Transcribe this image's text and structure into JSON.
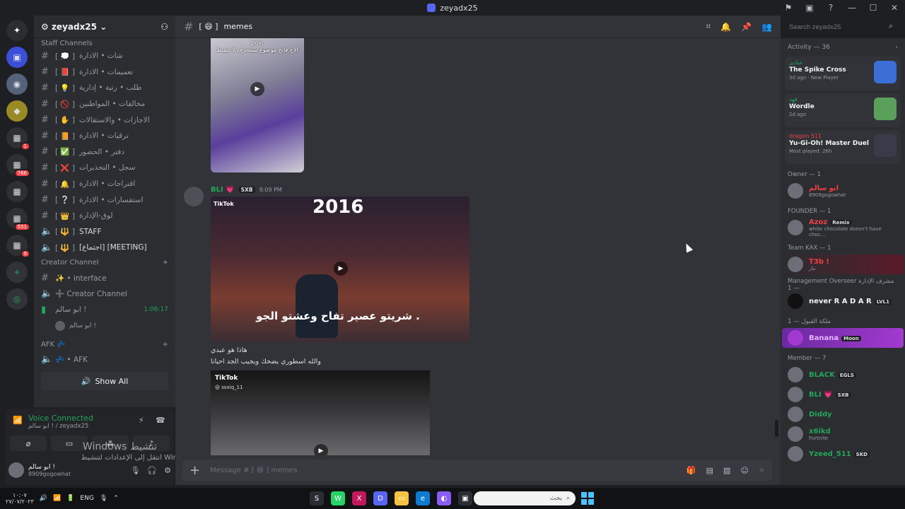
{
  "window": {
    "title": "zeyadx25",
    "controls": [
      "⚑",
      "▣",
      "?",
      "—",
      "☐",
      "✕"
    ]
  },
  "guilds": {
    "home_icon": "discord-icon",
    "badges": [
      "1",
      "766",
      "551",
      "9"
    ]
  },
  "server": {
    "name": "zeyadx25",
    "category_staff": "Staff Channels",
    "channels": [
      {
        "type": "text",
        "emoji_color": "#ffffff",
        "label": "شات • الادارة",
        "bracket": "[ 💭 ]"
      },
      {
        "type": "text",
        "emoji_color": "#e33c5a",
        "label": "تعميمات • الادارة",
        "bracket": "[ 📕 ]"
      },
      {
        "type": "text",
        "emoji_color": "#f5c242",
        "label": "طلب • رتبة • إدارية",
        "bracket": "[ 💡 ]"
      },
      {
        "type": "text",
        "emoji_color": "#e33c3c",
        "label": "مخالفات • المواطنين",
        "bracket": "[ 🚫 ]"
      },
      {
        "type": "text",
        "emoji_color": "#f0c8a0",
        "label": "الاجازات • والاستقالات",
        "bracket": "[ ✋ ]"
      },
      {
        "type": "text",
        "emoji_color": "#e8a33c",
        "label": "ترقيات • الادارة",
        "bracket": "[ 📙 ]"
      },
      {
        "type": "text",
        "emoji_color": "#3ca55c",
        "label": "دفتر • الحضور",
        "bracket": "[ ✅ ]"
      },
      {
        "type": "text",
        "emoji_color": "#e33c5a",
        "label": "سجل • التحذيرات",
        "bracket": "[ ❌ ]"
      },
      {
        "type": "text",
        "emoji_color": "#f5c242",
        "label": "اقتراحات • الادارة",
        "bracket": "[ 🔔 ]"
      },
      {
        "type": "text",
        "emoji_color": "#ffffff",
        "label": "استفسارات • الادارة",
        "bracket": "[ ❔ ]"
      },
      {
        "type": "text",
        "emoji_color": "#f5c242",
        "label": "لوق-الإدارة",
        "bracket": "[ 👑 ]"
      },
      {
        "type": "voice",
        "emoji_color": "#e8a33c",
        "label": "STAFF",
        "bracket": "[ 🔱 ]"
      },
      {
        "type": "voice",
        "emoji_color": "#e8a33c",
        "label": "[اجتماع] [MEETING]",
        "bracket": "[ 🔱 ]"
      }
    ],
    "category_creator": "Creator Channel",
    "creator_channels": [
      {
        "type": "text",
        "label": "✨ • interface"
      },
      {
        "type": "voice",
        "label": "➕ Creator Channel"
      }
    ],
    "voice_live": {
      "name": "ابو سالم !",
      "time": "1:06:17"
    },
    "voice_member": "ابو سالم !",
    "category_afk": "AFK 💤",
    "afk_channel": "💤 • AFK",
    "show_all": "Show All"
  },
  "voice_panel": {
    "title": "Voice Connected",
    "subtitle": "ابو سالم ! / zeyadx25",
    "user_name": "ابو سالم !",
    "user_status": "8909gogowhat"
  },
  "watermark": {
    "line1": "Windows تنشيط",
    "line2": "انتقل إلى الإعدادات لتنشيط Windows."
  },
  "channel": {
    "name": "memes",
    "bracket": "[ 😄 ]",
    "search_placeholder": "Search zeyadx25"
  },
  "messages": {
    "video1_caption_top": "pov:",
    "video1_caption": "الاخ فاتح موضوع سنتحرف لا تتمنط",
    "author": "BLI 💗",
    "author_tag": "SXB",
    "time": "9:09 PM",
    "video2_year": "2016",
    "video2_tiktok": "TikTok",
    "video2_caption": "شريتو عصير تفاح وعشتو الجو .",
    "line1": "هاذا هو عبدي",
    "line2": "والله اسطوري يضحك ويجيب الجد احيانا",
    "video3_tiktok": "TikTok",
    "video3_handle": "@ ssxiq_11"
  },
  "composer": {
    "placeholder": "Message # [ 😄 ] memes"
  },
  "members": {
    "activity_header": "Activity — 36",
    "activities": [
      {
        "user": "عبادي",
        "game": "The Spike Cross",
        "sub": "3d ago · New Player"
      },
      {
        "user": "فهد",
        "game": "Wordle",
        "sub": "2d ago"
      },
      {
        "user": "dragon 511",
        "game": "Yu-Gi-Oh! Master Duel",
        "sub": "Most played: 26h"
      }
    ],
    "owner_header": "Owner — 1",
    "owner": {
      "name": "ابو سالم",
      "sub": "8909gogowhat"
    },
    "founder_header": "FOUNDER — 1",
    "founder": {
      "name": "Azoz",
      "tag": "Remix",
      "sub": "white chocolate doesn't have choc..."
    },
    "teamkax_header": "Team KAX — 1",
    "teamkax": {
      "name": "T3b !",
      "sub": "ننار"
    },
    "mgmt_header": "Management Overseer مشرف الإدارة — 1",
    "mgmt": {
      "name": "never R A D A R",
      "tag": "LVL1"
    },
    "queen_header": "ملكة القبول — 1",
    "queen": {
      "name": "Banana",
      "tag": "Moon"
    },
    "member_header": "Member — 7",
    "member_list": [
      {
        "name": "BLACK",
        "tag": "EGLS",
        "color": "#23a55a"
      },
      {
        "name": "BLI 💗",
        "tag": "SXB",
        "color": "#23a55a"
      },
      {
        "name": "Diddy",
        "tag": "",
        "color": "#23a55a"
      },
      {
        "name": "x6ikd",
        "tag": "",
        "color": "#23a55a",
        "sub": "Fortnite"
      },
      {
        "name": "Yzeed_511",
        "tag": "SKD",
        "color": "#23a55a"
      }
    ]
  },
  "taskbar": {
    "time": "١٠:٠٧",
    "date": "٢٧/٠٧/٢٠٢٣",
    "lang": "ENG",
    "search_placeholder": "بحث"
  },
  "colors": {
    "accent": "#5865f2",
    "online": "#23a55a",
    "badge": "#f23f43"
  }
}
